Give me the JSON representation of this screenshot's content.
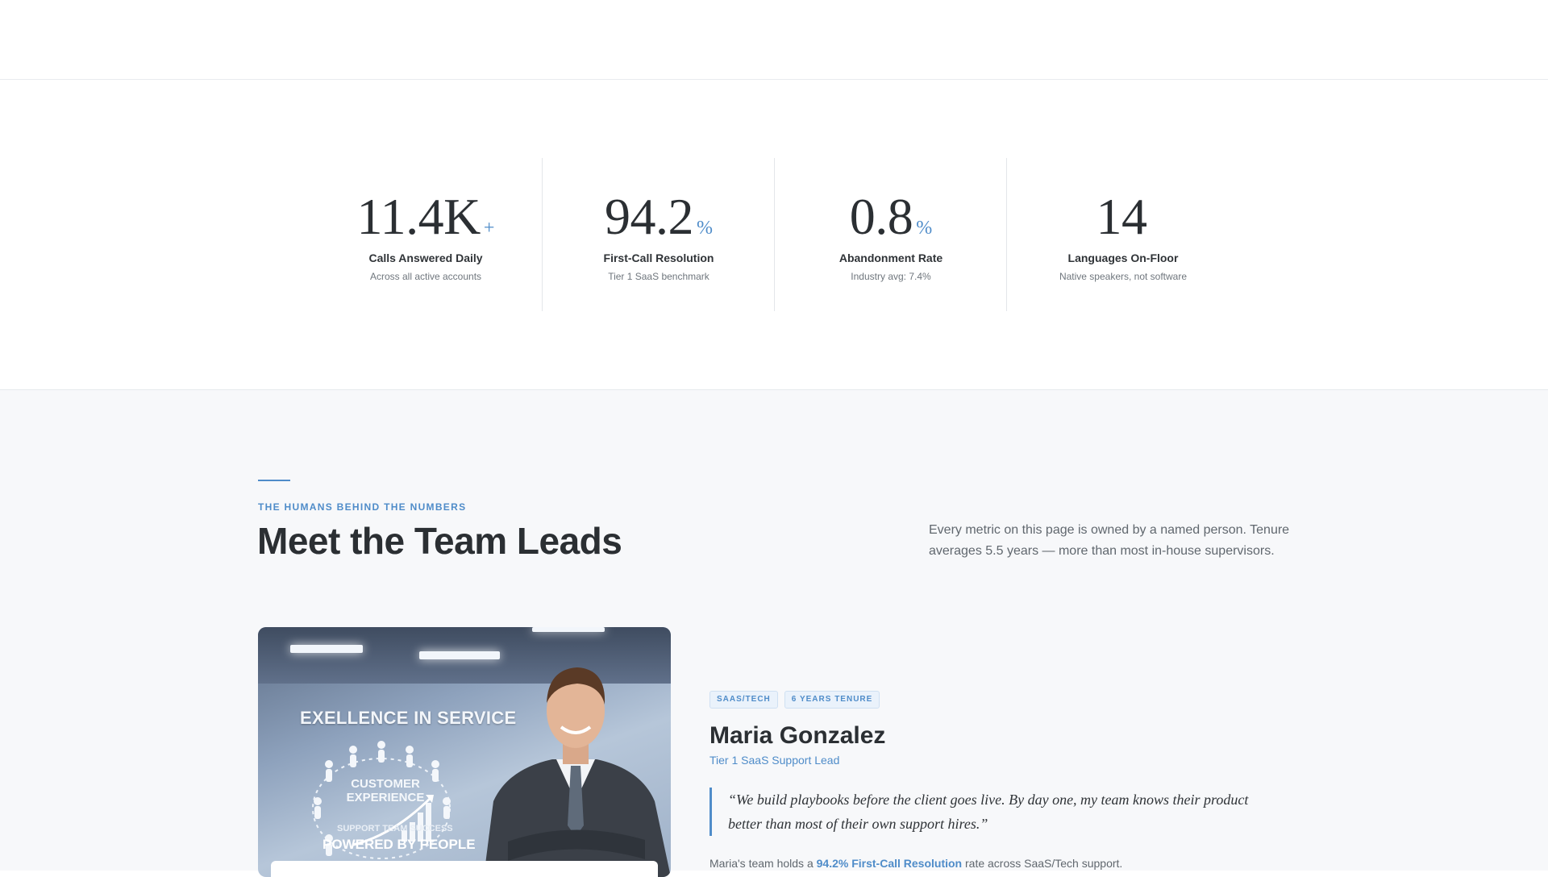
{
  "stats": [
    {
      "number": "11.4K",
      "suffix": "+",
      "label": "Calls Answered Daily",
      "sub": "Across all active accounts"
    },
    {
      "number": "94.2",
      "suffix": "%",
      "label": "First-Call Resolution",
      "sub": "Tier 1 SaaS benchmark"
    },
    {
      "number": "0.8",
      "suffix": "%",
      "label": "Abandonment Rate",
      "sub": "Industry avg: 7.4%"
    },
    {
      "number": "14",
      "suffix": "",
      "label": "Languages On-Floor",
      "sub": "Native speakers, not software"
    }
  ],
  "team": {
    "eyebrow": "THE HUMANS BEHIND THE NUMBERS",
    "title": "Meet the Team Leads",
    "intro": "Every metric on this page is owned by a named person. Tenure averages 5.5 years — more than most in-house supervisors."
  },
  "photo": {
    "poster_title": "EXELLENCE IN SERVICE",
    "poster_cx": "CUSTOMER EXPERIENCE",
    "poster_success": "SUPPORT TEAM SUCCESS",
    "poster_power": "POWERED BY PEOPLE"
  },
  "lead": {
    "tags": [
      "SAAS/TECH",
      "6 YEARS TENURE"
    ],
    "name": "Maria Gonzalez",
    "role": "Tier 1 SaaS Support Lead",
    "quote": "“We build playbooks before the client goes live. By day one, my team knows their product better than most of their own support hires.”",
    "stat_prefix": "Maria's team holds a ",
    "stat_highlight": "94.2% First-Call Resolution",
    "stat_suffix": " rate across SaaS/Tech support."
  },
  "colors": {
    "accent": "#4f8cc9",
    "text": "#2b2f33",
    "muted": "#60676e",
    "section_bg": "#f7f8fa"
  }
}
